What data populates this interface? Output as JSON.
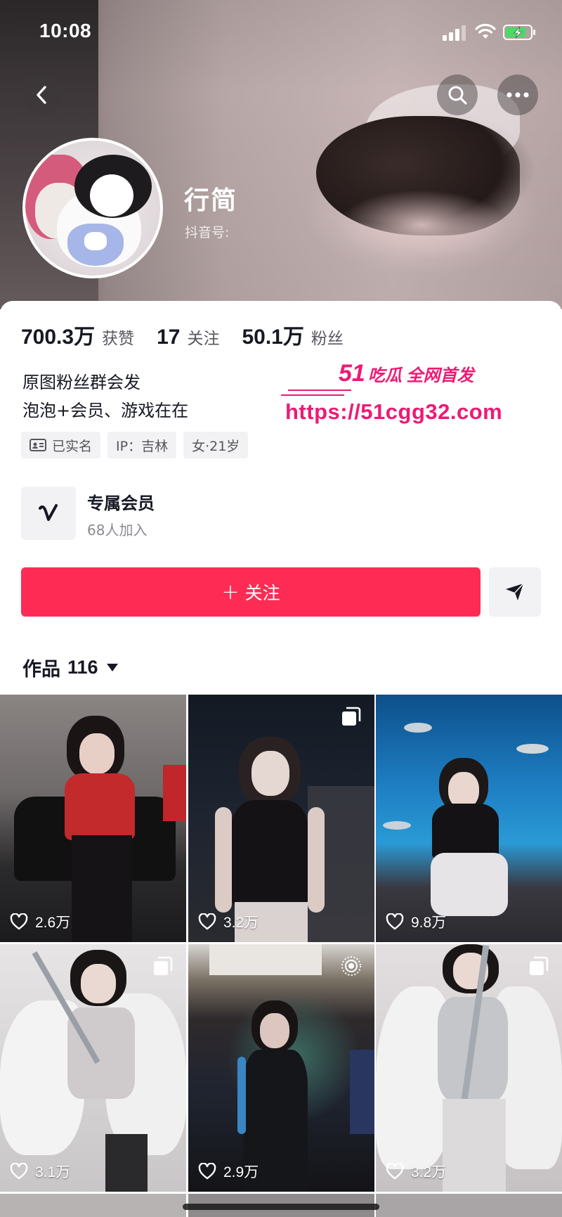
{
  "status_bar": {
    "time": "10:08"
  },
  "profile": {
    "nickname": "行简",
    "douyin_id_label": "抖音号:",
    "stats": [
      {
        "value": "700.3万",
        "label": "获赞"
      },
      {
        "value": "17",
        "label": "关注"
      },
      {
        "value": "50.1万",
        "label": "粉丝"
      }
    ],
    "bio_lines": [
      "原图粉丝群会发",
      "泡泡+会员、游戏在在"
    ],
    "tags": [
      "已实名",
      "IP：吉林",
      "女·21岁"
    ]
  },
  "watermark": {
    "brand_number": "51",
    "brand_text": "吃瓜 全网首发",
    "url": "https://51cgg32.com"
  },
  "membership": {
    "title": "专属会员",
    "subtitle": "68人加入"
  },
  "actions": {
    "follow_label": "关注"
  },
  "works": {
    "label": "作品",
    "count": "116"
  },
  "grid": [
    {
      "likes": "2.6万",
      "badge": ""
    },
    {
      "likes": "3.2万",
      "badge": "images-icon"
    },
    {
      "likes": "9.8万",
      "badge": ""
    },
    {
      "likes": "3.1万",
      "badge": "images-icon"
    },
    {
      "likes": "2.9万",
      "badge": "live-photo-icon"
    },
    {
      "likes": "3.2万",
      "badge": "images-icon"
    }
  ],
  "colors": {
    "accent": "#fe2c55",
    "watermark": "#ee1a74",
    "text": "#161823"
  }
}
